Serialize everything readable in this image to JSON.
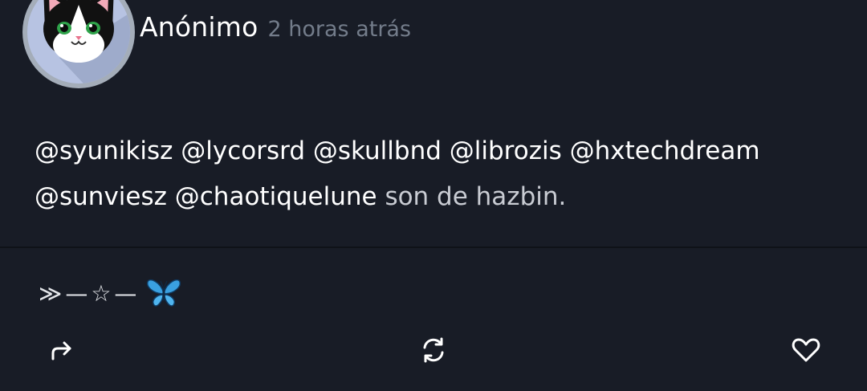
{
  "author": {
    "name": "Anónimo",
    "timestamp": "2 horas atrás",
    "avatar_icon": "cat-avatar-icon"
  },
  "post": {
    "mentions": [
      "@syunikisz",
      "@lycorsrd",
      "@skullbnd",
      "@librozis",
      "@hxtechdream",
      "@sunviesz",
      "@chaotiquelune"
    ],
    "text": "son de hazbin."
  },
  "signature": {
    "arrows": "≫",
    "dash_left": "—",
    "star": "☆",
    "dash_right": "—",
    "butterfly_icon": "butterfly-icon"
  },
  "actions": {
    "share_icon": "share-icon",
    "repost_icon": "repost-icon",
    "like_icon": "heart-icon"
  },
  "colors": {
    "background": "#181c26",
    "timestamp": "#737c8a",
    "body_text": "#c9ccd3",
    "butterfly": "#3aa0e0"
  }
}
